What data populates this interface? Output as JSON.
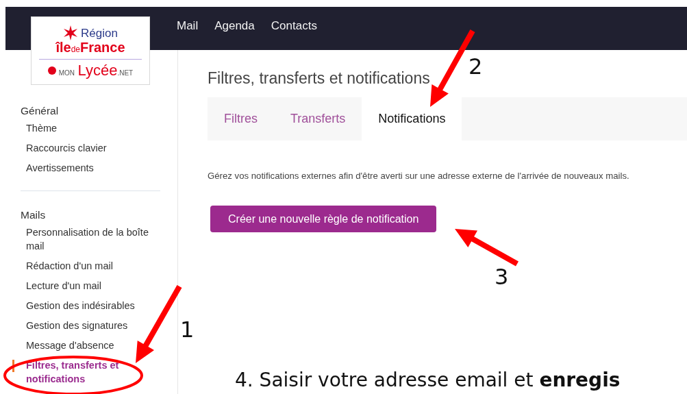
{
  "logo": {
    "region": "Région",
    "ile": "île",
    "de": "de",
    "france": "France",
    "mon": "MON",
    "lycee": "Lycée",
    "net": ".NET"
  },
  "nav": {
    "items": [
      "Mail",
      "Agenda",
      "Contacts"
    ]
  },
  "sidebar": {
    "sections": [
      {
        "title": "Général",
        "items": [
          {
            "label": "Thème",
            "selected": false
          },
          {
            "label": "Raccourcis clavier",
            "selected": false
          },
          {
            "label": "Avertissements",
            "selected": false
          }
        ]
      },
      {
        "title": "Mails",
        "items": [
          {
            "label": "Personnalisation de la boîte mail",
            "selected": false
          },
          {
            "label": "Rédaction d'un mail",
            "selected": false
          },
          {
            "label": "Lecture d'un mail",
            "selected": false
          },
          {
            "label": "Gestion des indésirables",
            "selected": false
          },
          {
            "label": "Gestion des signatures",
            "selected": false
          },
          {
            "label": "Message d'absence",
            "selected": false
          },
          {
            "label": "Filtres, transferts et notifications",
            "selected": true
          }
        ]
      }
    ]
  },
  "page_title": "Filtres, transferts et notifications",
  "tabs": [
    {
      "label": "Filtres",
      "selected": false
    },
    {
      "label": "Transferts",
      "selected": false
    },
    {
      "label": "Notifications",
      "selected": true
    }
  ],
  "description": "Gérez vos notifications externes afin d'être averti sur une adresse externe de l'arrivée de nouveaux mails.",
  "create_button": "Créer une nouvelle règle de notification",
  "annotations": [
    {
      "label": "1"
    },
    {
      "label": "2"
    },
    {
      "label": "3"
    }
  ],
  "caption": "4. Saisir votre adresse email et **enregis**"
}
